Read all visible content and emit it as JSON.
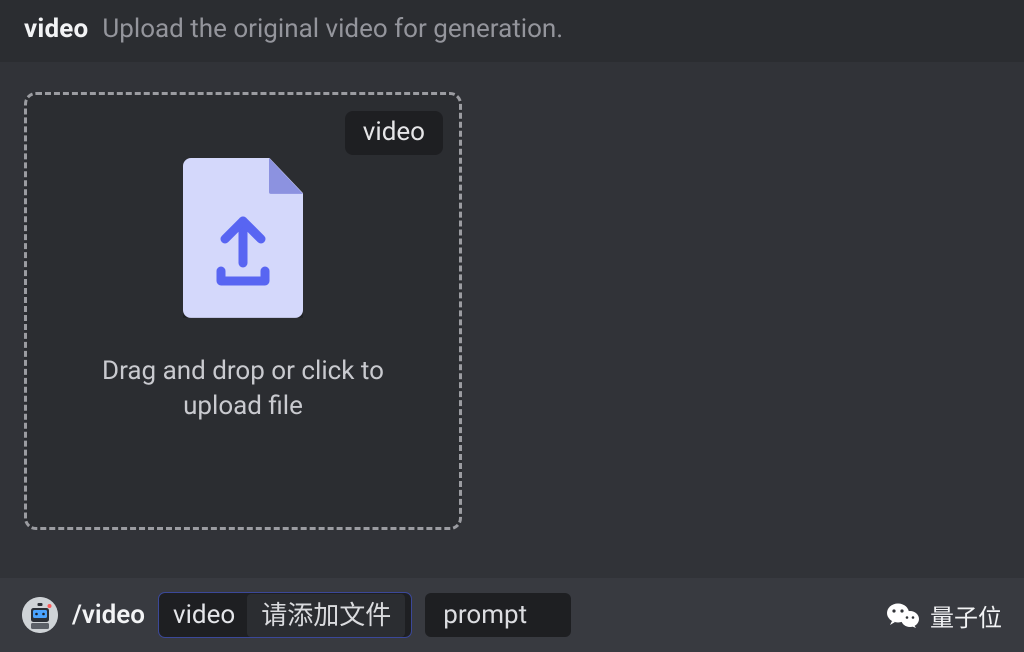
{
  "header": {
    "title": "video",
    "description": "Upload the original video for generation."
  },
  "upload": {
    "pill_label": "video",
    "dropzone_text": "Drag and drop or click to upload file",
    "icon_name": "file-upload-icon"
  },
  "command_bar": {
    "slash_command": "/video",
    "params": {
      "video": {
        "label": "video",
        "chip_text": "请添加文件"
      },
      "prompt": {
        "label": "prompt"
      }
    },
    "bot_avatar_name": "bot-avatar-icon"
  },
  "watermark": {
    "icon_name": "wechat-icon",
    "text": "量子位"
  }
}
